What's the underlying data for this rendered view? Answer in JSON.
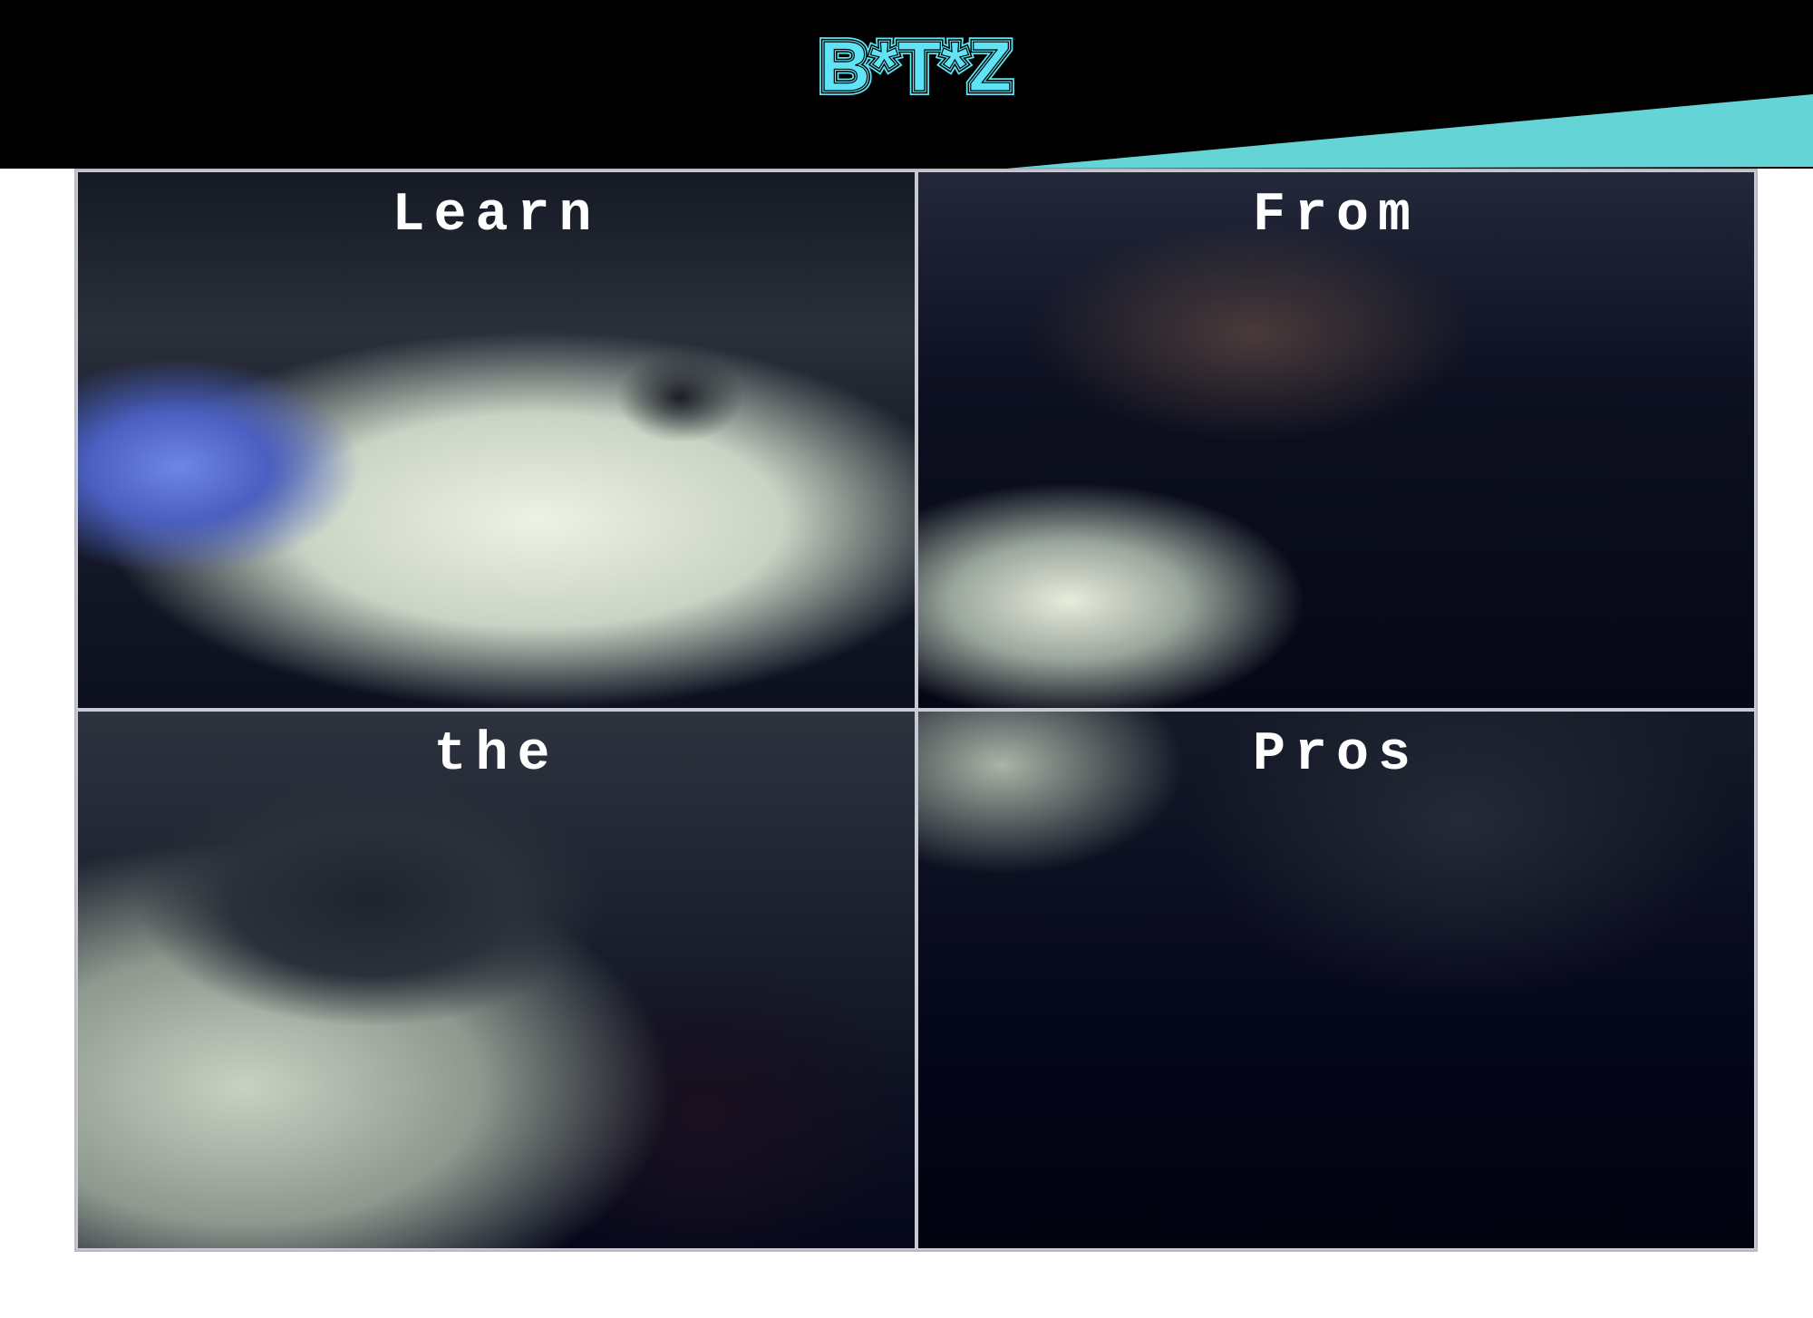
{
  "header": {
    "logo_text": "B*T*Z",
    "accent_color": "#64d4d6",
    "logo_color": "#5ee4f4"
  },
  "hero": {
    "panels": [
      {
        "label": "Learn"
      },
      {
        "label": "From"
      },
      {
        "label": "the"
      },
      {
        "label": "Pros"
      }
    ]
  }
}
